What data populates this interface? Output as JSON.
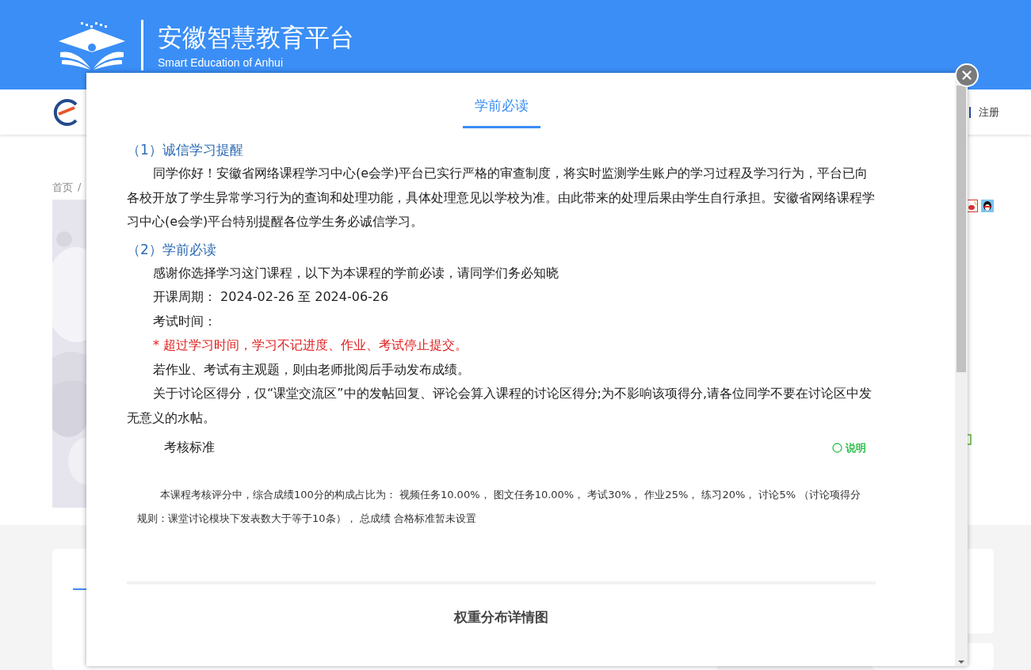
{
  "header": {
    "title": "安徽智慧教育平台",
    "subtitle": "Smart Education of Anhui"
  },
  "nav": {
    "links": [
      "注册"
    ]
  },
  "breadcrumb": {
    "items": [
      "首页"
    ],
    "separator": "/"
  },
  "modal": {
    "tabs": [
      {
        "label": "学前必读",
        "selected": true
      }
    ],
    "sections": [
      {
        "heading": "（1）诚信学习提醒",
        "paragraphs": [
          {
            "kind": "plain",
            "text": "同学你好！安徽省网络课程学习中心(e会学)平台已实行严格的审查制度，将实时监测学生账户的学习过程及学习行为，平台已向各校开放了学生异常学习行为的查询和处理功能，具体处理意见以学校为准。由此带来的处理后果由学生自行承担。安徽省网络课程学习中心(e会学)平台特别提醒各位学生务必诚信学习。"
          }
        ]
      },
      {
        "heading": "（2）学前必读",
        "paragraphs": [
          {
            "kind": "plain",
            "text": "感谢你选择学习这门课程，以下为本课程的学前必读，请同学们务必知晓"
          },
          {
            "kind": "plain",
            "text": "开课周期：  2024-02-26 至 2024-06-26"
          },
          {
            "kind": "plain",
            "text": "考试时间："
          },
          {
            "kind": "warning",
            "text": "* 超过学习时间，学习不记进度、作业、考试停止提交。"
          },
          {
            "kind": "plain",
            "text": "若作业、考试有主观题，则由老师批阅后手动发布成绩。"
          },
          {
            "kind": "plain",
            "text": "关于讨论区得分，仅“课堂交流区”中的发帖回复、评论会算入课程的讨论区得分;为不影响该项得分,请各位同学不要在讨论区中发无意义的水帖。"
          }
        ]
      }
    ],
    "assessment": {
      "title": "考核标准",
      "link": "说明",
      "description": "本课程考核评分中，综合成绩100分的构成占比为： 视频任务10.00%， 图文任务10.00%， 考试30%， 作业25%， 练习20%， 讨论5% （讨论项得分规则：课堂讨论模块下发表数大于等于10条）， 总成绩 合格标准暂未设置"
    },
    "chart_heading": "权重分布详情图"
  }
}
